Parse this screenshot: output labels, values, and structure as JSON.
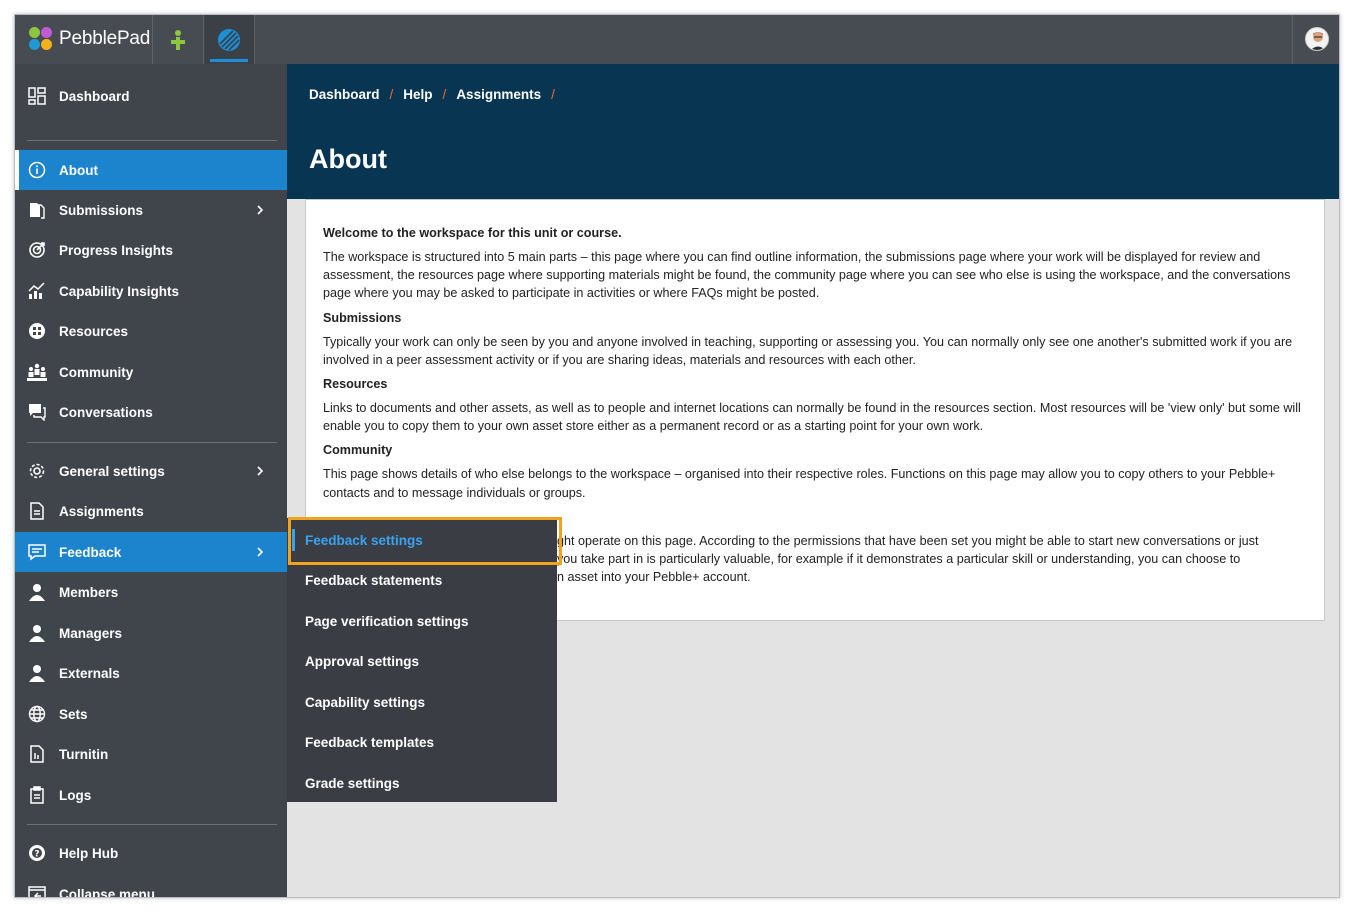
{
  "app": {
    "brand": "PebblePad",
    "colors": {
      "accent": "#1c84cd",
      "header": "#073552",
      "sidebar": "#40444b",
      "highlight": "#f0a41e",
      "crumb_separator": "#e76f2a"
    }
  },
  "topbar": {
    "apps": [
      {
        "name": "pebble-plus-icon"
      },
      {
        "name": "atlas-icon"
      }
    ],
    "avatar": "user-avatar"
  },
  "sidebar": {
    "items": [
      {
        "label": "Dashboard",
        "icon": "dashboard-icon"
      },
      {
        "label": "About",
        "icon": "info-icon"
      },
      {
        "label": "Submissions",
        "icon": "submissions-icon"
      },
      {
        "label": "Progress Insights",
        "icon": "target-icon"
      },
      {
        "label": "Capability Insights",
        "icon": "bar-chart-icon"
      },
      {
        "label": "Resources",
        "icon": "resources-icon"
      },
      {
        "label": "Community",
        "icon": "community-icon"
      },
      {
        "label": "Conversations",
        "icon": "conversations-icon"
      },
      {
        "label": "General settings",
        "icon": "gear-icon"
      },
      {
        "label": "Assignments",
        "icon": "document-icon"
      },
      {
        "label": "Feedback",
        "icon": "feedback-icon"
      },
      {
        "label": "Members",
        "icon": "person-icon"
      },
      {
        "label": "Managers",
        "icon": "person-icon"
      },
      {
        "label": "Externals",
        "icon": "person-icon"
      },
      {
        "label": "Sets",
        "icon": "globe-icon"
      },
      {
        "label": "Turnitin",
        "icon": "document-icon"
      },
      {
        "label": "Logs",
        "icon": "clipboard-icon"
      },
      {
        "label": "Help Hub",
        "icon": "help-icon"
      },
      {
        "label": "Collapse menu",
        "icon": "collapse-icon"
      }
    ]
  },
  "header": {
    "breadcrumbs": [
      "Dashboard",
      "Help",
      "Assignments"
    ],
    "title": "About"
  },
  "content": {
    "welcome": "Welcome to the workspace for this unit or course.",
    "intro": "The workspace is structured into 5 main parts – this page where you can find outline information, the submissions page where your work will be displayed for review and assessment, the resources page where supporting materials might be found, the community page where you can see who else is using the workspace, and the conversations page where you may be asked to participate in activities or where FAQs might be posted.",
    "submissions_heading": "Submissions",
    "submissions_text": "Typically your work can only be seen by you and anyone involved in teaching, supporting or assessing you. You can normally only see one another's submitted work if you are involved in a peer assessment activity or if you are sharing ideas, materials and resources with each other.",
    "resources_heading": "Resources",
    "resources_text": "Links to documents and other assets, as well as to people and internet locations can normally be found in the resources section. Most resources will be 'view only' but some will enable you to copy them to your own asset store either as a permanent record or as a starting point for your own work.",
    "community_heading": "Community",
    "community_text": "This page shows details of who else belongs to the workspace – organised into their respective roles. Functions on this page may allow you to copy others to your Pebble+ contacts and to message individuals or groups.",
    "conversations_line1": "ght operate on this page. According to the permissions that have been set you might be able to start new conversations or just",
    "conversations_line2": "you take part in is particularly valuable, for example if it demonstrates a particular skill or understanding, you can choose to",
    "conversations_line3": "n asset into your Pebble+ account."
  },
  "flyout": {
    "items": [
      "Feedback settings",
      "Feedback statements",
      "Page verification settings",
      "Approval settings",
      "Capability settings",
      "Feedback templates",
      "Grade settings"
    ]
  }
}
